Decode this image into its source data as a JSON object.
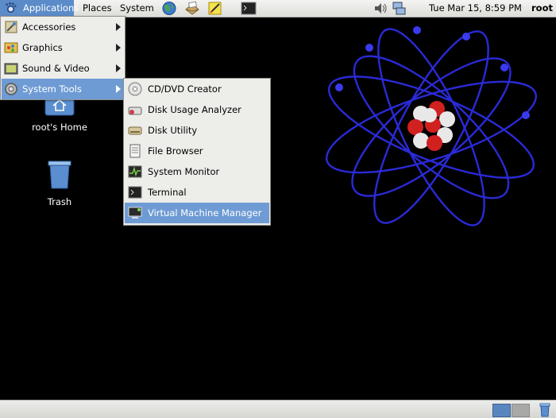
{
  "top_panel": {
    "applications_label": "Applications",
    "places_label": "Places",
    "system_label": "System",
    "launchers": [
      "web-browser-icon",
      "email-client-icon",
      "notes-editor-icon",
      "terminal-icon"
    ],
    "clock": "Tue Mar 15,  8:59 PM",
    "user": "root"
  },
  "desktop": {
    "background_color": "#000000",
    "home_label": "root's Home",
    "trash_label": "Trash"
  },
  "applications_menu": {
    "items": [
      {
        "label": "Accessories",
        "icon": "accessories-icon",
        "has_submenu": true
      },
      {
        "label": "Graphics",
        "icon": "graphics-icon",
        "has_submenu": true
      },
      {
        "label": "Sound & Video",
        "icon": "sound-video-icon",
        "has_submenu": true
      },
      {
        "label": "System Tools",
        "icon": "system-tools-icon",
        "has_submenu": true,
        "selected": true
      }
    ]
  },
  "system_tools_menu": {
    "items": [
      {
        "label": "CD/DVD Creator",
        "icon": "cd-dvd-icon"
      },
      {
        "label": "Disk Usage Analyzer",
        "icon": "disk-usage-icon"
      },
      {
        "label": "Disk Utility",
        "icon": "disk-utility-icon"
      },
      {
        "label": "File Browser",
        "icon": "file-browser-icon"
      },
      {
        "label": "System Monitor",
        "icon": "system-monitor-icon"
      },
      {
        "label": "Terminal",
        "icon": "terminal-icon"
      },
      {
        "label": "Virtual Machine Manager",
        "icon": "virtual-machine-icon",
        "selected": true
      }
    ]
  },
  "bottom_panel": {
    "workspaces": [
      {
        "active": true
      },
      {
        "active": false
      }
    ]
  },
  "colors": {
    "selection": "#6e9bd4",
    "panel_active": "#5b8bc8",
    "atom_orbit": "#2a2ad8",
    "nucleus_red": "#d02020",
    "nucleus_white": "#e8e8e8"
  }
}
